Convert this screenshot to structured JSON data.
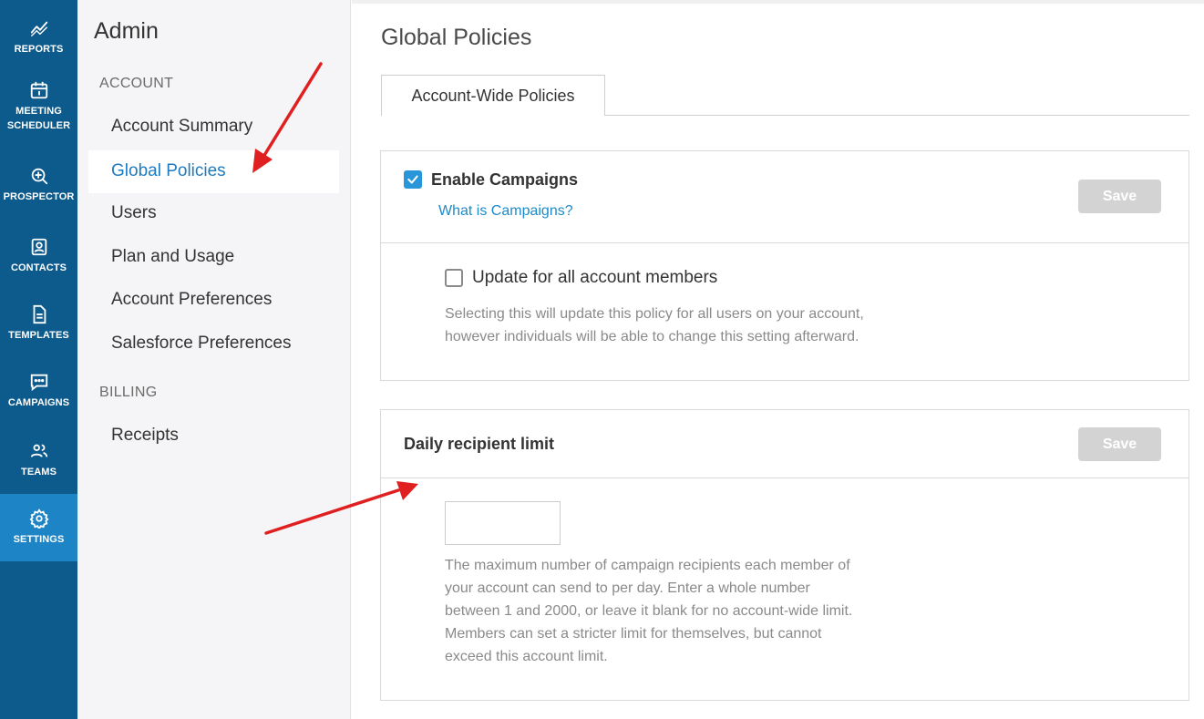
{
  "rail": {
    "items": [
      {
        "label": "REPORTS",
        "icon": "chart-line-icon"
      },
      {
        "label": "MEETING SCHEDULER",
        "icon": "calendar-icon"
      },
      {
        "label": "PROSPECTOR",
        "icon": "zoom-plus-icon"
      },
      {
        "label": "CONTACTS",
        "icon": "contact-card-icon"
      },
      {
        "label": "TEMPLATES",
        "icon": "document-icon"
      },
      {
        "label": "CAMPAIGNS",
        "icon": "chat-bubble-icon"
      },
      {
        "label": "TEAMS",
        "icon": "people-icon"
      },
      {
        "label": "SETTINGS",
        "icon": "gear-icon"
      }
    ],
    "active": "SETTINGS",
    "bg_color": "#0d5a8c",
    "active_color": "#1d84c6"
  },
  "subnav": {
    "title": "Admin",
    "sections": [
      {
        "heading": "ACCOUNT",
        "items": [
          "Account Summary",
          "Global Policies",
          "Users",
          "Plan and Usage",
          "Account Preferences",
          "Salesforce Preferences"
        ]
      },
      {
        "heading": "BILLING",
        "items": [
          "Receipts"
        ]
      }
    ],
    "active_item": "Global Policies",
    "active_color": "#1e7bbf"
  },
  "main": {
    "page_title": "Global Policies",
    "tabs": [
      {
        "label": "Account-Wide Policies"
      }
    ],
    "campaigns_panel": {
      "enable_label": "Enable Campaigns",
      "enabled": true,
      "help_link": "What is Campaigns?",
      "save_label": "Save",
      "update_all_label": "Update for all account members",
      "update_all_checked": false,
      "update_help": [
        "Selecting this will update this policy for all users on your account,",
        "however individuals will be able to change this setting afterward."
      ]
    },
    "limit_panel": {
      "title": "Daily recipient limit",
      "save_label": "Save",
      "input_value": "",
      "help": [
        "The maximum number of campaign recipients each member of",
        "your account can send to per day. Enter a whole number",
        "between 1 and 2000, or leave it blank for no account-wide limit.",
        "Members can set a stricter limit for themselves, but cannot",
        "exceed this account limit."
      ]
    }
  },
  "colors": {
    "checkbox_checked": "#2996da",
    "save_disabled": "#d3d3d3",
    "link": "#1e8ac8",
    "annotation_arrow": "#e02020"
  }
}
